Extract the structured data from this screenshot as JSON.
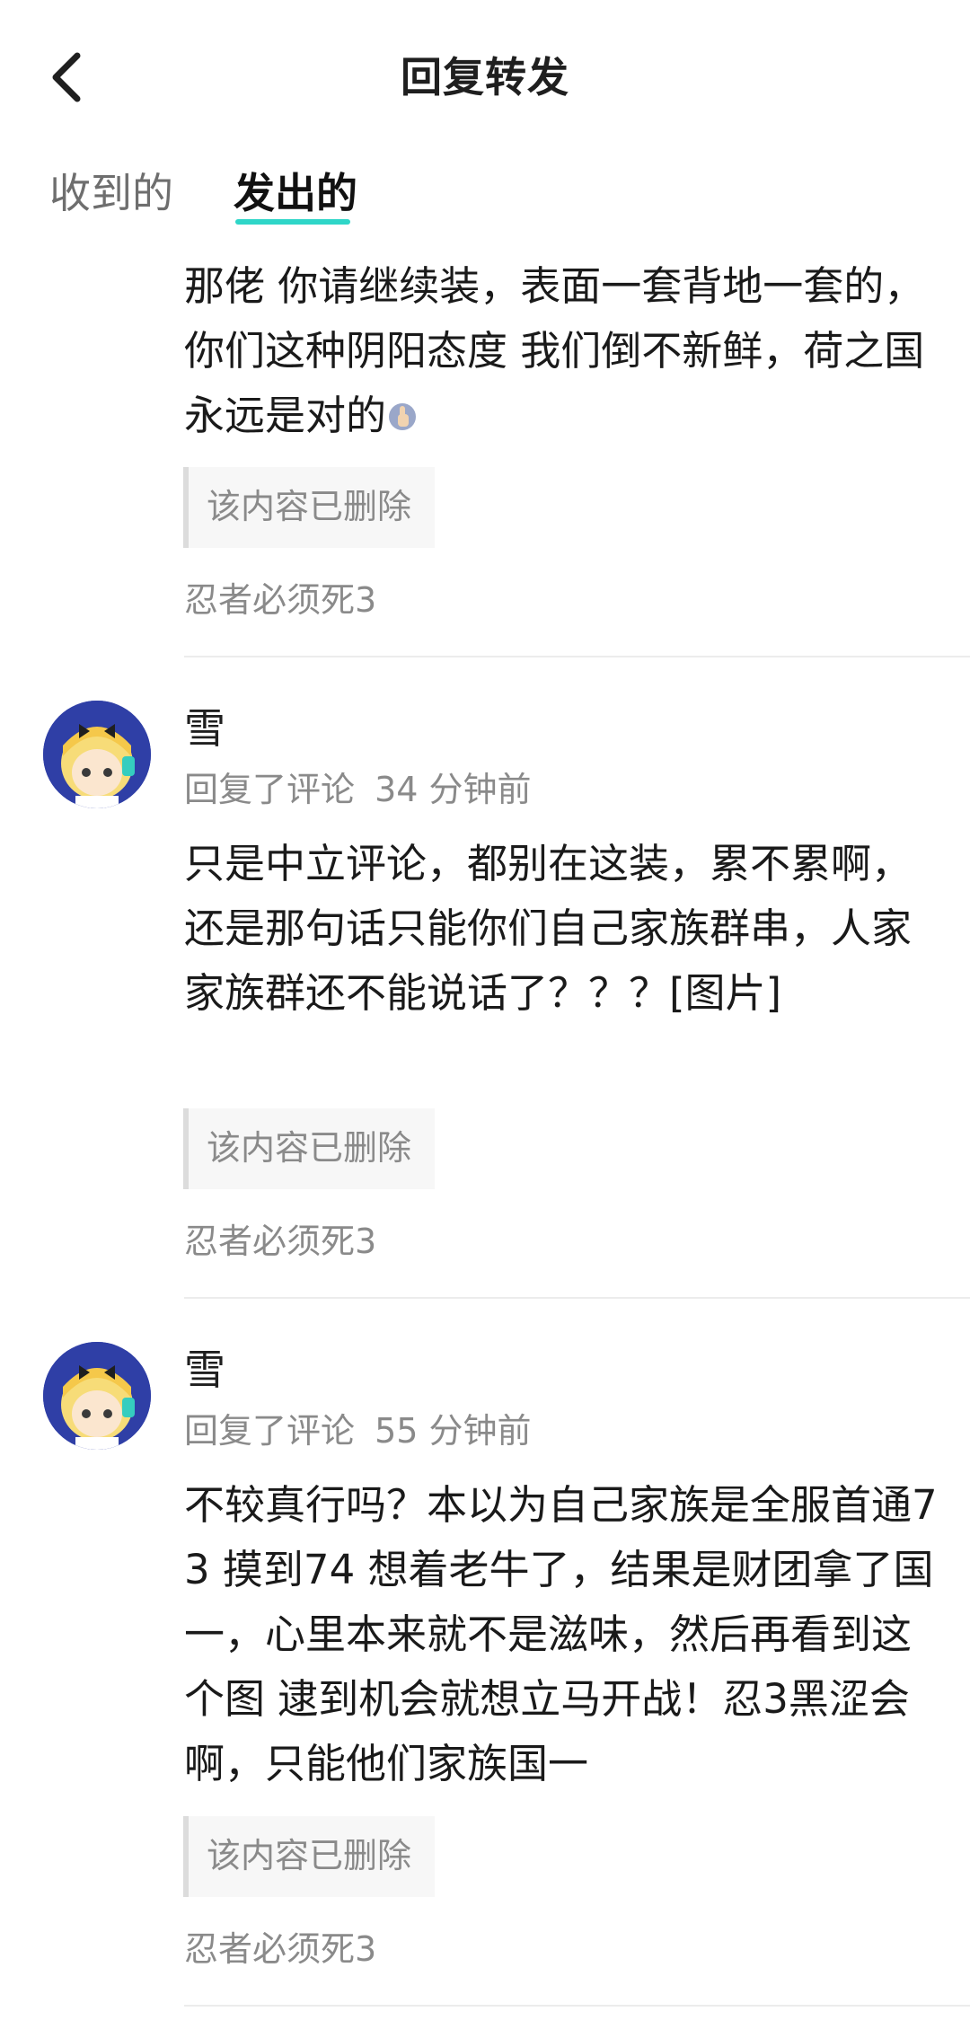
{
  "header": {
    "title": "回复转发",
    "back_icon": "chevron-left-icon"
  },
  "tabs": [
    {
      "label": "收到的",
      "active": false
    },
    {
      "label": "发出的",
      "active": true
    }
  ],
  "accent_color": "#2fd6c8",
  "items": [
    {
      "body": "那佬  你请继续装，表面一套背地一套的，你们这种阴阳态度  我们倒不新鲜，荷之国永远是对的",
      "emoji": "thumbs-up-icon",
      "quote": "该内容已删除",
      "source": "忍者必须死3"
    },
    {
      "username": "雪",
      "action": "回复了评论",
      "time": "34  分钟前",
      "body": "只是中立评论，都别在这装，累不累啊，还是那句话只能你们自己家族群串，人家家族群还不能说话了？？？[图片]",
      "quote": "该内容已删除",
      "source": "忍者必须死3"
    },
    {
      "username": "雪",
      "action": "回复了评论",
      "time": "55  分钟前",
      "body": "不较真行吗？本以为自己家族是全服首通73  摸到74  想着老牛了，结果是财团拿了国一，心里本来就不是滋味，然后再看到这个图  逮到机会就想立马开战！忍3黑涩会啊，只能他们家族国一",
      "quote": "该内容已删除",
      "source": "忍者必须死3"
    }
  ]
}
